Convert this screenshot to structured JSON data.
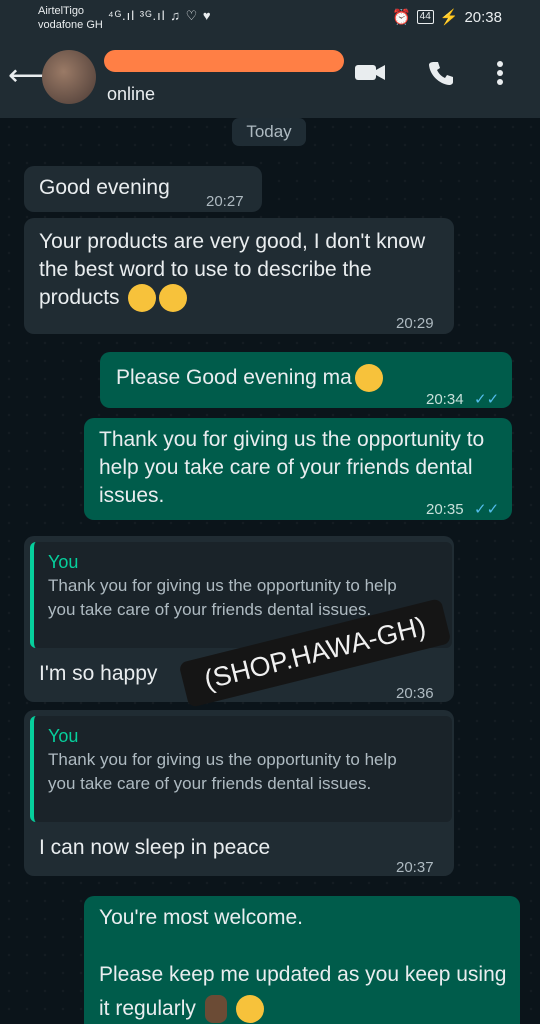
{
  "status_bar": {
    "carrier1": "AirtelTigo",
    "carrier2": "vodafone GH",
    "icons": "⁴ᴳ.ıl ³ᴳ.ıl ♫ ♡ ♥",
    "battery": "44",
    "time": "20:38"
  },
  "header": {
    "status": "online"
  },
  "chat": {
    "date_chip": "Today",
    "messages": [
      {
        "text": "Good evening",
        "time": "20:27"
      },
      {
        "text": "Your products are very good, I don't know the best word to use to describe the products",
        "time": "20:29"
      },
      {
        "text": "Please Good evening ma",
        "time": "20:34"
      },
      {
        "text": "Thank you for giving us the opportunity to help you take care of your friends dental issues.",
        "time": "20:35"
      },
      {
        "quote_name": "You",
        "quote_text": "Thank you for giving us the opportunity to help you take care of your friends dental issues.",
        "text": "I'm so happy",
        "time": "20:36"
      },
      {
        "quote_name": "You",
        "quote_text": "Thank you for giving us the opportunity to help you take care of your friends dental issues.",
        "text": "I can now sleep in peace",
        "time": "20:37"
      },
      {
        "text1": "You're most welcome.",
        "text2": "Please keep me updated as you keep using it regularly"
      }
    ]
  },
  "watermark": "(SHOP.HAWA-GH)",
  "icons": {
    "back": "arrow-left-icon",
    "video": "video-camera-icon",
    "call": "phone-icon",
    "menu": "more-vertical-icon"
  },
  "colors": {
    "incoming": "#202c33",
    "outgoing": "#005c4b",
    "read_ticks": "#53bdeb",
    "quote_accent": "#06cf9c"
  }
}
